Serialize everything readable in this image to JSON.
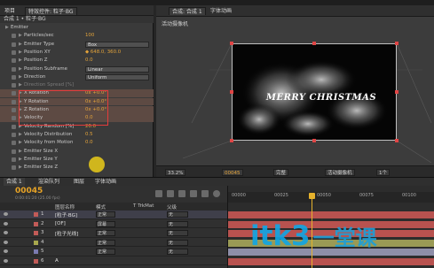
{
  "fx_panel": {
    "tabs": [
      "项目",
      "特效控件: 粒子·BG"
    ],
    "subtitle": "合成 1 • 粒子·BG",
    "rows": [
      {
        "name": "Emitter",
        "value": "",
        "type": "group"
      },
      {
        "name": "Particles/sec",
        "value": "100",
        "type": "value"
      },
      {
        "name": "Emitter Type",
        "value": "Box",
        "type": "dropdown"
      },
      {
        "name": "Position XY",
        "value": "◆ 648.0, 360.0",
        "type": "value"
      },
      {
        "name": "Position Z",
        "value": "0.0",
        "type": "value"
      },
      {
        "name": "Position Subframe",
        "value": "Linear",
        "type": "dropdown"
      },
      {
        "name": "Direction",
        "value": "Uniform",
        "type": "dropdown"
      },
      {
        "name": "Direction Spread [%]",
        "value": "",
        "type": "dim"
      },
      {
        "name": "X Rotation",
        "value": "0x +0.0°",
        "type": "value"
      },
      {
        "name": "Y Rotation",
        "value": "0x +0.0°",
        "type": "value"
      },
      {
        "name": "Z Rotation",
        "value": "0x +0.0°",
        "type": "value"
      },
      {
        "name": "Velocity",
        "value": "0.0",
        "type": "value"
      },
      {
        "name": "Velocity Random [%]",
        "value": "20.0",
        "type": "value"
      },
      {
        "name": "Velocity Distribution",
        "value": "0.5",
        "type": "value"
      },
      {
        "name": "Velocity from Motion",
        "value": "0.0",
        "type": "value"
      },
      {
        "name": "Emitter Size X",
        "value": "",
        "type": "value"
      },
      {
        "name": "Emitter Size Y",
        "value": "",
        "type": "value"
      },
      {
        "name": "Emitter Size Z",
        "value": "",
        "type": "value"
      }
    ]
  },
  "comp_panel": {
    "tabs": [
      "合成: 合成 1",
      "字体动画"
    ],
    "view_label": "活动摄像机",
    "overlay_text": "MERRY CHRISTMAS",
    "toolbar": [
      "33.2%",
      "00045",
      "完整",
      "活动摄像机",
      "1个"
    ]
  },
  "timeline": {
    "tabs": [
      "合成 1",
      "渲染队列",
      "图层",
      "字体动画"
    ],
    "timecode": "00045",
    "fps": "0:00:01:20 (25.00 fps)",
    "ruler_ticks": [
      "00000",
      "00025",
      "00050",
      "00075",
      "00100"
    ],
    "columns": {
      "name": "图层名称",
      "mode": "模式",
      "trkmat": "T TrkMat",
      "parent": "父级"
    },
    "layers": [
      {
        "num": "1",
        "name": "[粒子·BG]",
        "mode": "正常",
        "parent": "无",
        "label_color": "#c25b58",
        "bar_color": "#b8524f"
      },
      {
        "num": "2",
        "name": "[OF]",
        "mode": "屏幕",
        "parent": "无",
        "label_color": "#c25b58",
        "bar_color": "#b8524f"
      },
      {
        "num": "3",
        "name": "[粒子光线]",
        "mode": "正常",
        "parent": "无",
        "label_color": "#c25b58",
        "bar_color": "#b8524f"
      },
      {
        "num": "4",
        "name": "",
        "mode": "正常",
        "parent": "无",
        "label_color": "#a8a84e",
        "bar_color": "#9a9a55"
      },
      {
        "num": "5",
        "name": "",
        "mode": "正常",
        "parent": "无",
        "label_color": "#7b7bb0",
        "bar_color": "#8e8ea8"
      },
      {
        "num": "6",
        "name": "A",
        "mode": "",
        "parent": "",
        "label_color": "#c25b58",
        "bar_color": "#b8524f"
      }
    ]
  },
  "watermark": {
    "latin": "itk3",
    "cn": "一堂课"
  }
}
